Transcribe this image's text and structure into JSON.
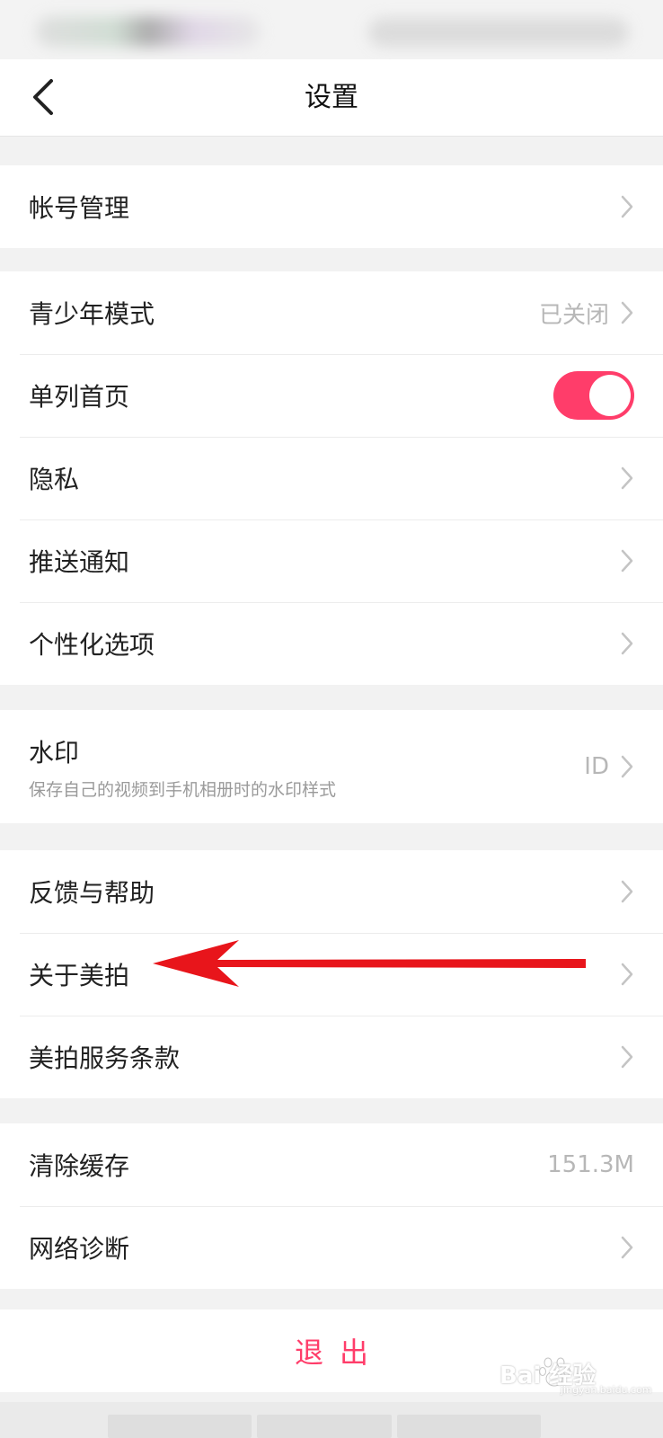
{
  "header": {
    "title": "设置"
  },
  "groups": [
    {
      "items": [
        {
          "label": "帐号管理"
        }
      ]
    },
    {
      "items": [
        {
          "label": "青少年模式",
          "value": "已关闭"
        },
        {
          "label": "单列首页",
          "toggle_on": true
        },
        {
          "label": "隐私"
        },
        {
          "label": "推送通知"
        },
        {
          "label": "个性化选项"
        }
      ]
    },
    {
      "items": [
        {
          "label": "水印",
          "subtitle": "保存自己的视频到手机相册时的水印样式",
          "value": "ID"
        }
      ]
    },
    {
      "items": [
        {
          "label": "反馈与帮助"
        },
        {
          "label": "关于美拍"
        },
        {
          "label": "美拍服务条款"
        }
      ]
    },
    {
      "items": [
        {
          "label": "清除缓存",
          "value": "151.3M"
        },
        {
          "label": "网络诊断"
        }
      ]
    }
  ],
  "logout": {
    "label": "退出"
  },
  "watermark": {
    "text": "Bai 经验",
    "sub": "jingyan.baidu.com"
  },
  "colors": {
    "accent": "#ff3d6a",
    "annotation_arrow": "#e8151b"
  }
}
